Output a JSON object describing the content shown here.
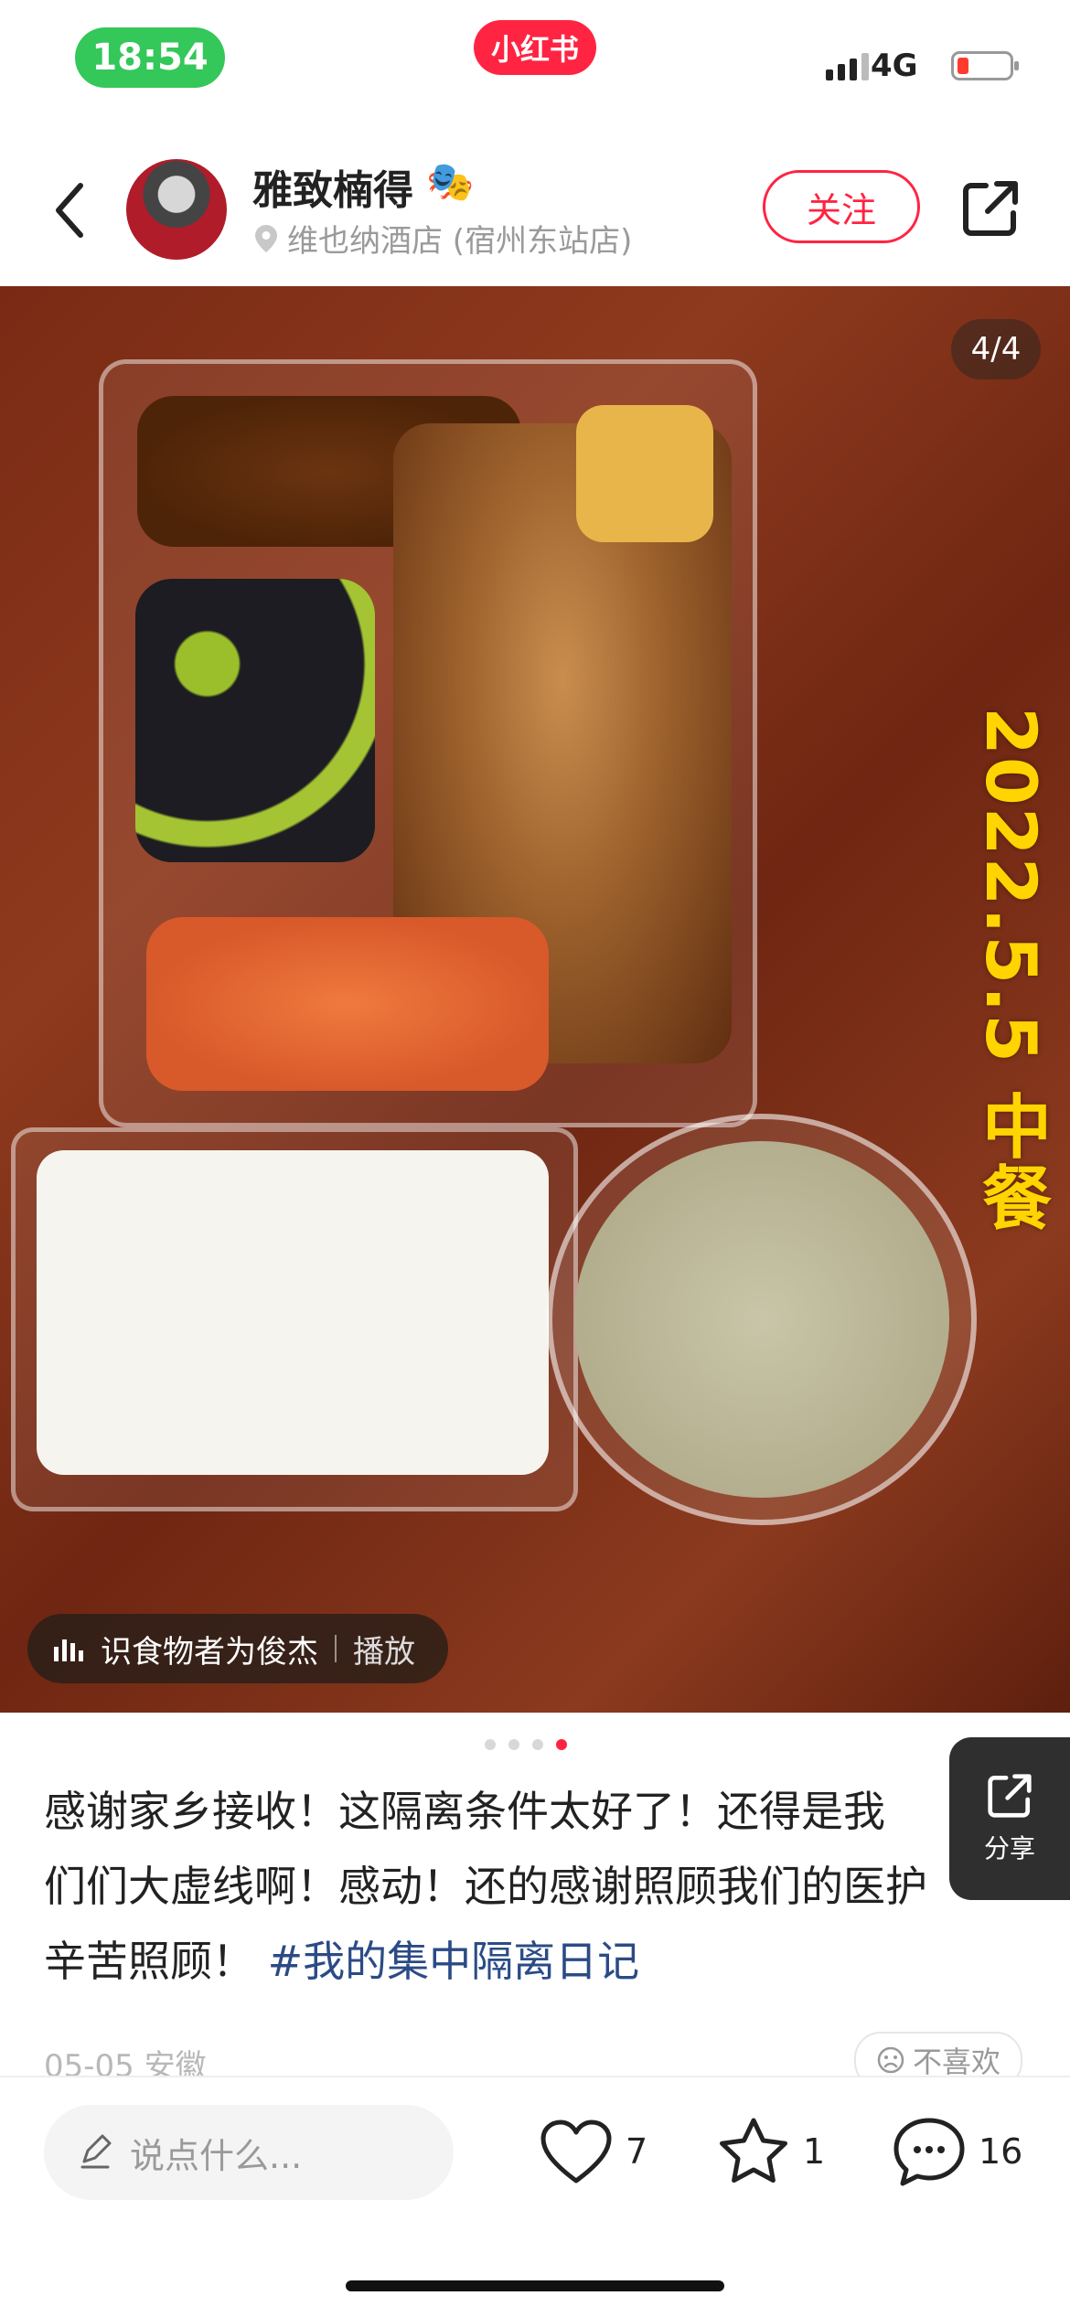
{
  "status_bar": {
    "time": "18:54",
    "network": "4G",
    "battery_color": "#ff3b30"
  },
  "app": {
    "logo_text": "小红书",
    "brand_color": "#ff2442"
  },
  "header": {
    "author_name": "雅致楠得",
    "author_emoji": "🎭",
    "location": "维也纳酒店 (宿州东站店)",
    "follow_label": "关注"
  },
  "photo": {
    "page_counter": "4/4",
    "date_stamp": "2022.5.5 中餐",
    "music_name": "识食物者为俊杰",
    "music_action": "播放",
    "page_dots": {
      "count": 4,
      "active_index": 3
    }
  },
  "float_share": {
    "label": "分享"
  },
  "post": {
    "lines": [
      "感谢家乡接收！这隔离条件太好了！还得是我",
      "们们大虚线啊！感动！还的感谢照顾我们的医护",
      "辛苦照顾！"
    ],
    "hashtag": "#我的集中隔离日记",
    "date": "05-05",
    "region": "安徽",
    "dislike_label": "不喜欢"
  },
  "bottom_bar": {
    "comment_placeholder": "说点什么...",
    "likes": "7",
    "collects": "1",
    "comments": "16"
  },
  "icons": [
    "back-icon",
    "location-pin-icon",
    "share-icon",
    "music-bars-icon",
    "edit-icon",
    "heart-icon",
    "star-icon",
    "comment-icon",
    "dislike-face-icon"
  ]
}
